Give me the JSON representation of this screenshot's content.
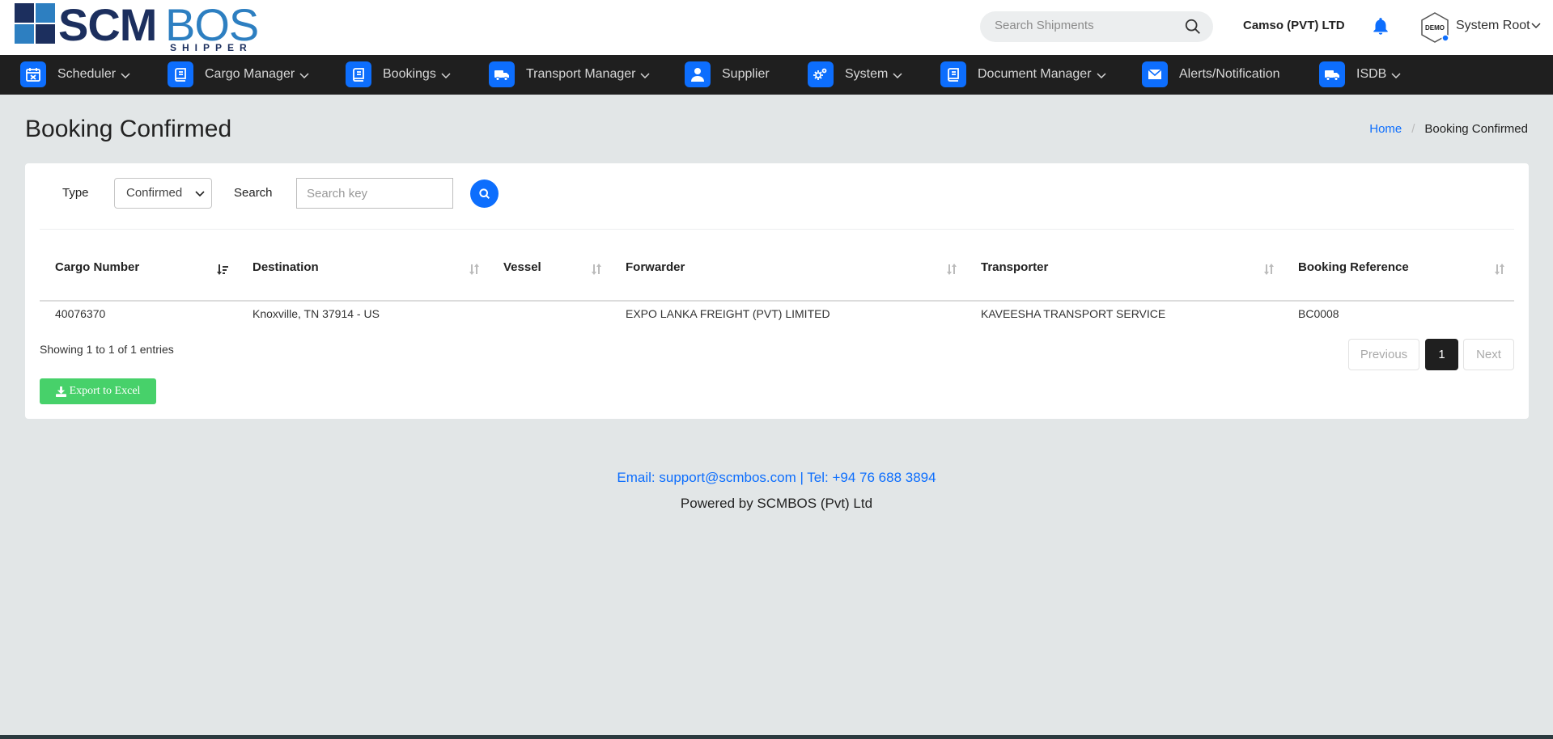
{
  "logo": {
    "primary": "SCM",
    "secondary": "BOS",
    "tagline": "SHIPPER"
  },
  "header": {
    "search_placeholder": "Search Shipments",
    "company": "Camso (PVT) LTD",
    "avatar_text": "DEMO",
    "user_name": "System Root"
  },
  "nav": {
    "items": [
      {
        "label": "Scheduler",
        "icon": "calendar-icon",
        "dropdown": true
      },
      {
        "label": "Cargo Manager",
        "icon": "book-icon",
        "dropdown": true
      },
      {
        "label": "Bookings",
        "icon": "book-icon",
        "dropdown": true
      },
      {
        "label": "Transport Manager",
        "icon": "truck-icon",
        "dropdown": true
      },
      {
        "label": "Supplier",
        "icon": "user-icon",
        "dropdown": false
      },
      {
        "label": "System",
        "icon": "gears-icon",
        "dropdown": true
      },
      {
        "label": "Document Manager",
        "icon": "book-icon",
        "dropdown": true
      },
      {
        "label": "Alerts/Notification",
        "icon": "envelope-icon",
        "dropdown": false
      },
      {
        "label": "ISDB",
        "icon": "truck-icon",
        "dropdown": true
      }
    ]
  },
  "page": {
    "title": "Booking Confirmed",
    "breadcrumb_home": "Home",
    "breadcrumb_sep": "/",
    "breadcrumb_current": "Booking Confirmed"
  },
  "filters": {
    "type_label": "Type",
    "type_value": "Confirmed",
    "search_label": "Search",
    "search_placeholder": "Search key"
  },
  "table": {
    "columns": [
      "Cargo Number",
      "Destination",
      "Vessel",
      "Forwarder",
      "Transporter",
      "Booking Reference"
    ],
    "rows": [
      [
        "40076370",
        "Knoxville, TN 37914 - US",
        "",
        "EXPO LANKA FREIGHT (PVT) LIMITED",
        "KAVEESHA TRANSPORT SERVICE",
        "BC0008"
      ]
    ],
    "info": "Showing 1 to 1 of 1 entries",
    "pagination": {
      "previous": "Previous",
      "current": "1",
      "next": "Next"
    }
  },
  "export_label": "Export to Excel",
  "footer": {
    "contact": "Email: support@scmbos.com | Tel: +94 76 688 3894",
    "powered": "Powered by SCMBOS (Pvt) Ltd"
  },
  "colors": {
    "accent": "#0d6efd",
    "nav_bg": "#1f1f1f",
    "page_bg": "#e2e6e7",
    "export_green": "#47d16a",
    "logo_dark": "#1c2f5e",
    "logo_light": "#2d7fc1"
  }
}
